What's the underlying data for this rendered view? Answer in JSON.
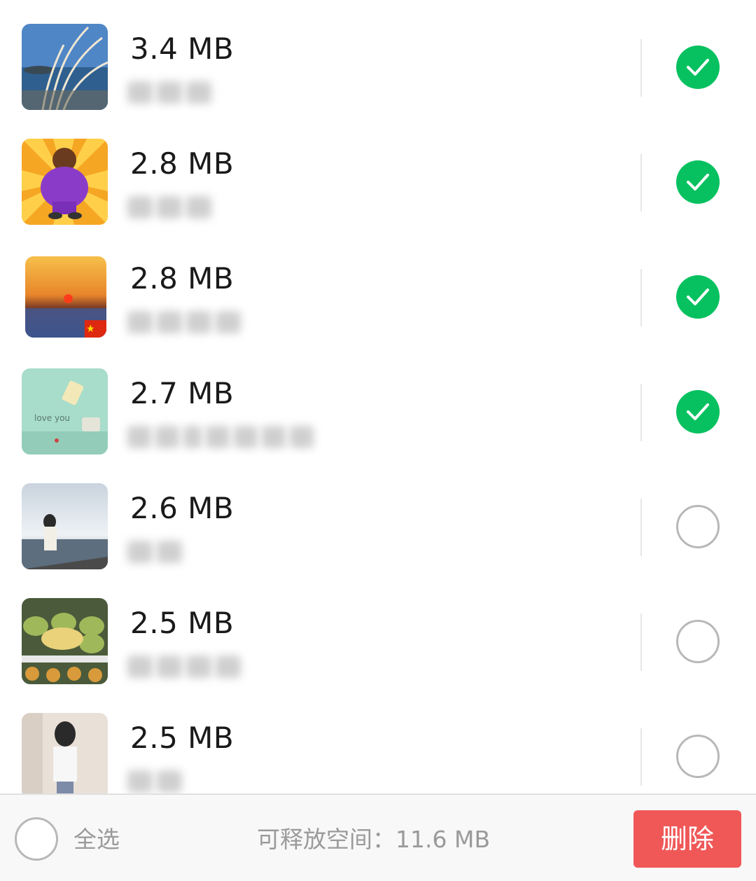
{
  "items": [
    {
      "size": "3.4 MB",
      "name": "▒▒▒",
      "checked": true,
      "name_blocks": [
        3
      ],
      "avatar": "avatar-reeds-seaside"
    },
    {
      "size": "2.8 MB",
      "name": "▒▒▒",
      "checked": true,
      "name_blocks": [
        3
      ],
      "avatar": "avatar-cartoon-basketball"
    },
    {
      "size": "2.8 MB",
      "name": "▒▒▒▒",
      "checked": true,
      "name_blocks": [
        4
      ],
      "avatar": "avatar-sunset"
    },
    {
      "size": "2.7 MB",
      "name": "▒▒ (▒▒▒▒)",
      "checked": true,
      "name_blocks": [
        6
      ],
      "avatar": "avatar-mint-photo"
    },
    {
      "size": "2.6 MB",
      "name": "▒▒",
      "checked": false,
      "name_blocks": [
        2
      ],
      "avatar": "avatar-girl-sea"
    },
    {
      "size": "2.5 MB",
      "name": "▒▒▒▒",
      "checked": false,
      "name_blocks": [
        4
      ],
      "avatar": "avatar-mango"
    },
    {
      "size": "2.5 MB",
      "name": "▒▒",
      "checked": false,
      "name_blocks": [
        2
      ],
      "avatar": "avatar-girl-illustration"
    }
  ],
  "footer": {
    "select_all": "全选",
    "free_space": "可释放空间：11.6 MB",
    "delete": "删除"
  },
  "colors": {
    "check_green": "#07c160",
    "delete_red": "#f05858"
  }
}
